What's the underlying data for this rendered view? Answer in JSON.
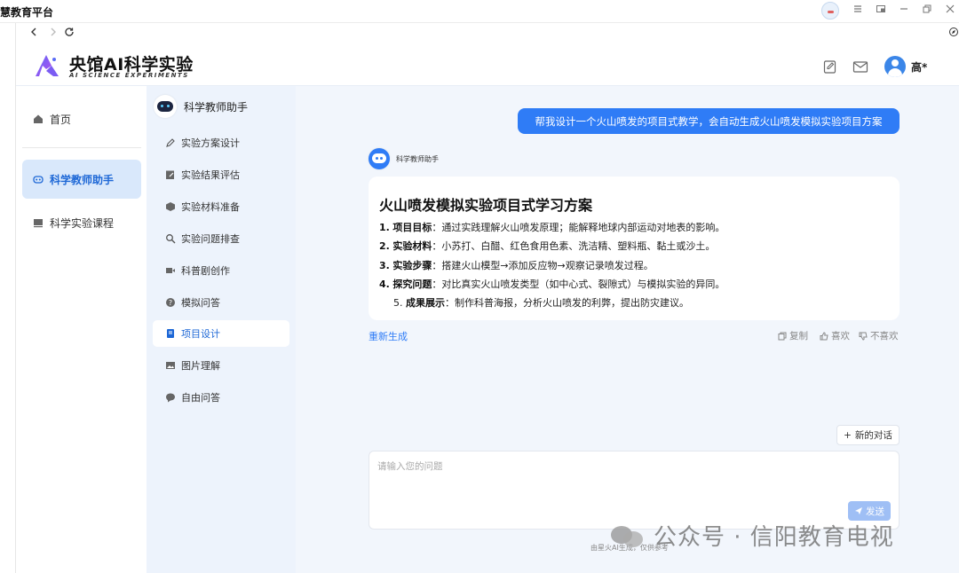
{
  "window": {
    "title": "慧教育平台"
  },
  "header": {
    "logo_title": "央馆AI科学实验",
    "logo_subtitle": "AI SCIENCE EXPERIMENTS",
    "username": "高*"
  },
  "sidebar": {
    "items": [
      {
        "label": "首页",
        "icon": "home-icon",
        "active": false
      },
      {
        "label": "科学教师助手",
        "icon": "robot-icon",
        "active": true
      },
      {
        "label": "科学实验课程",
        "icon": "course-icon",
        "active": false
      }
    ]
  },
  "subpanel": {
    "title": "科学教师助手",
    "items": [
      {
        "label": "实验方案设计",
        "icon": "pencil-icon"
      },
      {
        "label": "实验结果评估",
        "icon": "edit-icon"
      },
      {
        "label": "实验材料准备",
        "icon": "cube-icon"
      },
      {
        "label": "实验问题排查",
        "icon": "search-icon"
      },
      {
        "label": "科普剧创作",
        "icon": "video-icon"
      },
      {
        "label": "模拟问答",
        "icon": "question-icon"
      },
      {
        "label": "项目设计",
        "icon": "book-icon",
        "active": true
      },
      {
        "label": "图片理解",
        "icon": "image-icon"
      },
      {
        "label": "自由问答",
        "icon": "chat-icon"
      }
    ]
  },
  "chat": {
    "user_message": "帮我设计一个火山喷发的项目式教学，会自动生成火山喷发模拟实验项目方案",
    "bot_name": "科学教师助手",
    "answer": {
      "title": "火山喷发模拟实验项目式学习方案",
      "points": [
        {
          "num": "1.",
          "label": "项目目标",
          "text": "：通过实践理解火山喷发原理；能解释地球内部运动对地表的影响。"
        },
        {
          "num": "2.",
          "label": "实验材料",
          "text": "：小苏打、白醋、红色食用色素、洗洁精、塑料瓶、黏土或沙土。"
        },
        {
          "num": "3.",
          "label": "实验步骤",
          "text": "：搭建火山模型→添加反应物→观察记录喷发过程。"
        },
        {
          "num": "4.",
          "label": "探究问题",
          "text": "：对比真实火山喷发类型（如中心式、裂隙式）与模拟实验的异同。"
        },
        {
          "num": "5.",
          "label": "成果展示",
          "text": "：制作科普海报，分析火山喷发的利弊，提出防灾建议。"
        }
      ]
    },
    "regenerate_label": "重新生成",
    "copy_label": "复制",
    "like_label": "喜欢",
    "dislike_label": "不喜欢",
    "new_chat_label": "新的对话",
    "input_placeholder": "请输入您的问题",
    "send_label": "发送",
    "disclaimer": "由星火AI生成，仅供参考"
  },
  "watermark": "公众号 · 信阳教育电视",
  "colors": {
    "accent": "#2f7cf6",
    "sidebar_active_bg": "#d9e8fb",
    "subpanel_bg": "#edf3fc",
    "main_bg": "#f2f6fc"
  }
}
